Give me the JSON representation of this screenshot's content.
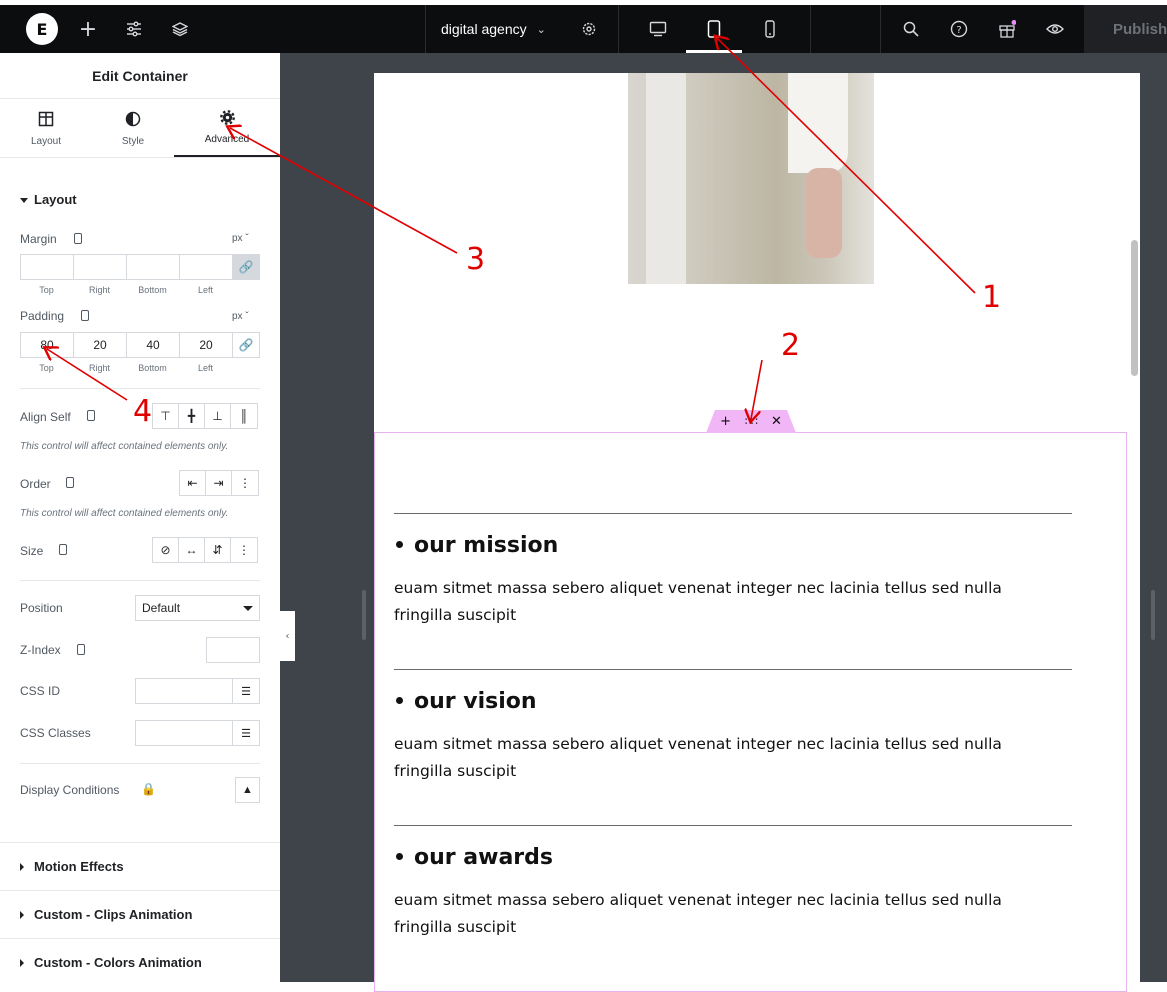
{
  "topbar": {
    "site_name": "digital agency",
    "publish_label": "Publish",
    "icons": [
      "elementor-logo-icon",
      "add-icon",
      "settings-sliders-icon",
      "layers-icon",
      "chevron-down-icon",
      "gear-icon",
      "desktop-icon",
      "tablet-icon",
      "mobile-icon",
      "search-icon",
      "help-icon",
      "gift-icon",
      "eye-icon"
    ],
    "logo_text": "E"
  },
  "panel": {
    "title": "Edit Container",
    "tabs": [
      {
        "label": "Layout",
        "icon": "layout-icon"
      },
      {
        "label": "Style",
        "icon": "style-icon"
      },
      {
        "label": "Advanced",
        "icon": "gear-icon",
        "active": true
      }
    ],
    "layout_section": "Layout",
    "margin": {
      "label": "Margin",
      "unit": "px",
      "values": [
        "",
        "",
        "",
        ""
      ]
    },
    "padding": {
      "label": "Padding",
      "unit": "px",
      "values": [
        "80",
        "20",
        "40",
        "20"
      ]
    },
    "side_labels": [
      "Top",
      "Right",
      "Bottom",
      "Left"
    ],
    "align_self": "Align Self",
    "note": "This control will affect contained elements only.",
    "order": "Order",
    "size": "Size",
    "position": {
      "label": "Position",
      "value": "Default"
    },
    "z_index": "Z-Index",
    "css_id": "CSS ID",
    "css_classes": "CSS Classes",
    "display_conditions": "Display Conditions",
    "accordions": [
      "Motion Effects",
      "Custom - Clips Animation",
      "Custom - Colors Animation"
    ]
  },
  "canvas": {
    "sections": [
      {
        "heading": "our mission",
        "text": "euam sitmet massa sebero aliquet venenat integer nec lacinia tellus sed nulla fringilla suscipit"
      },
      {
        "heading": "our vision",
        "text": "euam sitmet massa sebero aliquet venenat integer nec lacinia tellus sed nulla fringilla suscipit"
      },
      {
        "heading": "our awards",
        "text": "euam sitmet massa sebero aliquet venenat integer nec lacinia tellus sed nulla fringilla suscipit"
      }
    ]
  },
  "annotations": [
    "1",
    "2",
    "3",
    "4"
  ],
  "colors": {
    "annotation": "#e00000",
    "handle": "#f0b6f6",
    "topbar": "#0c0d0e"
  }
}
